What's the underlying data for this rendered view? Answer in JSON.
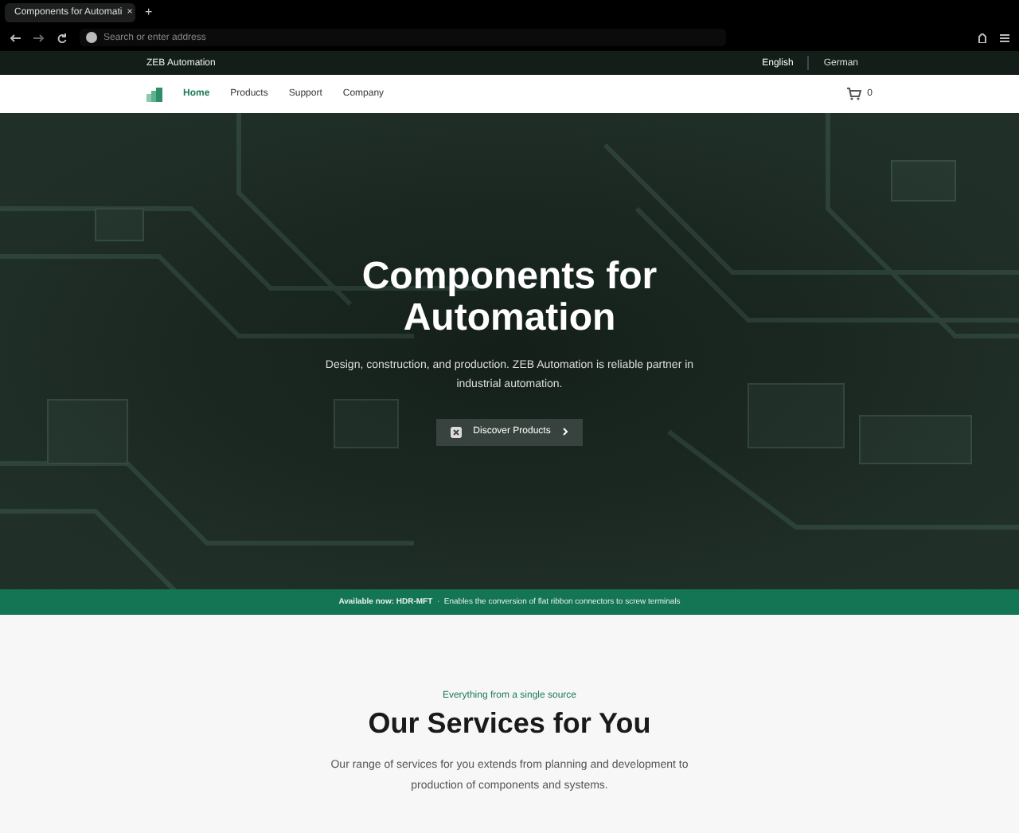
{
  "browser": {
    "tab": {
      "title": "Components for Automati",
      "close": "×"
    },
    "new_tab": "+",
    "address": {
      "placeholder": "Search or enter address"
    }
  },
  "top_bar": {
    "brand": "ZEB Automation",
    "languages": [
      {
        "label": "English",
        "selected": true
      },
      {
        "label": "German",
        "selected": false
      }
    ]
  },
  "nav": {
    "items": [
      {
        "label": "Home",
        "selected": true
      },
      {
        "label": "Products",
        "selected": false
      },
      {
        "label": "Support",
        "selected": false
      },
      {
        "label": "Company",
        "selected": false
      }
    ],
    "cart_count": "0"
  },
  "hero": {
    "title": "Components for Automation",
    "subtitle": "Design, construction, and production. ZEB Automation is reliable partner in industrial automation.",
    "button": "Discover Products"
  },
  "banner": {
    "text": "**Available now: HDR-MFT**  ·  Enables the conversion of flat ribbon connectors to screw terminals"
  },
  "services": {
    "eyebrow": "Everything from a single source",
    "title": "Our Services for You",
    "text": "Our range of services for you extends from planning and development to production of components and systems."
  }
}
